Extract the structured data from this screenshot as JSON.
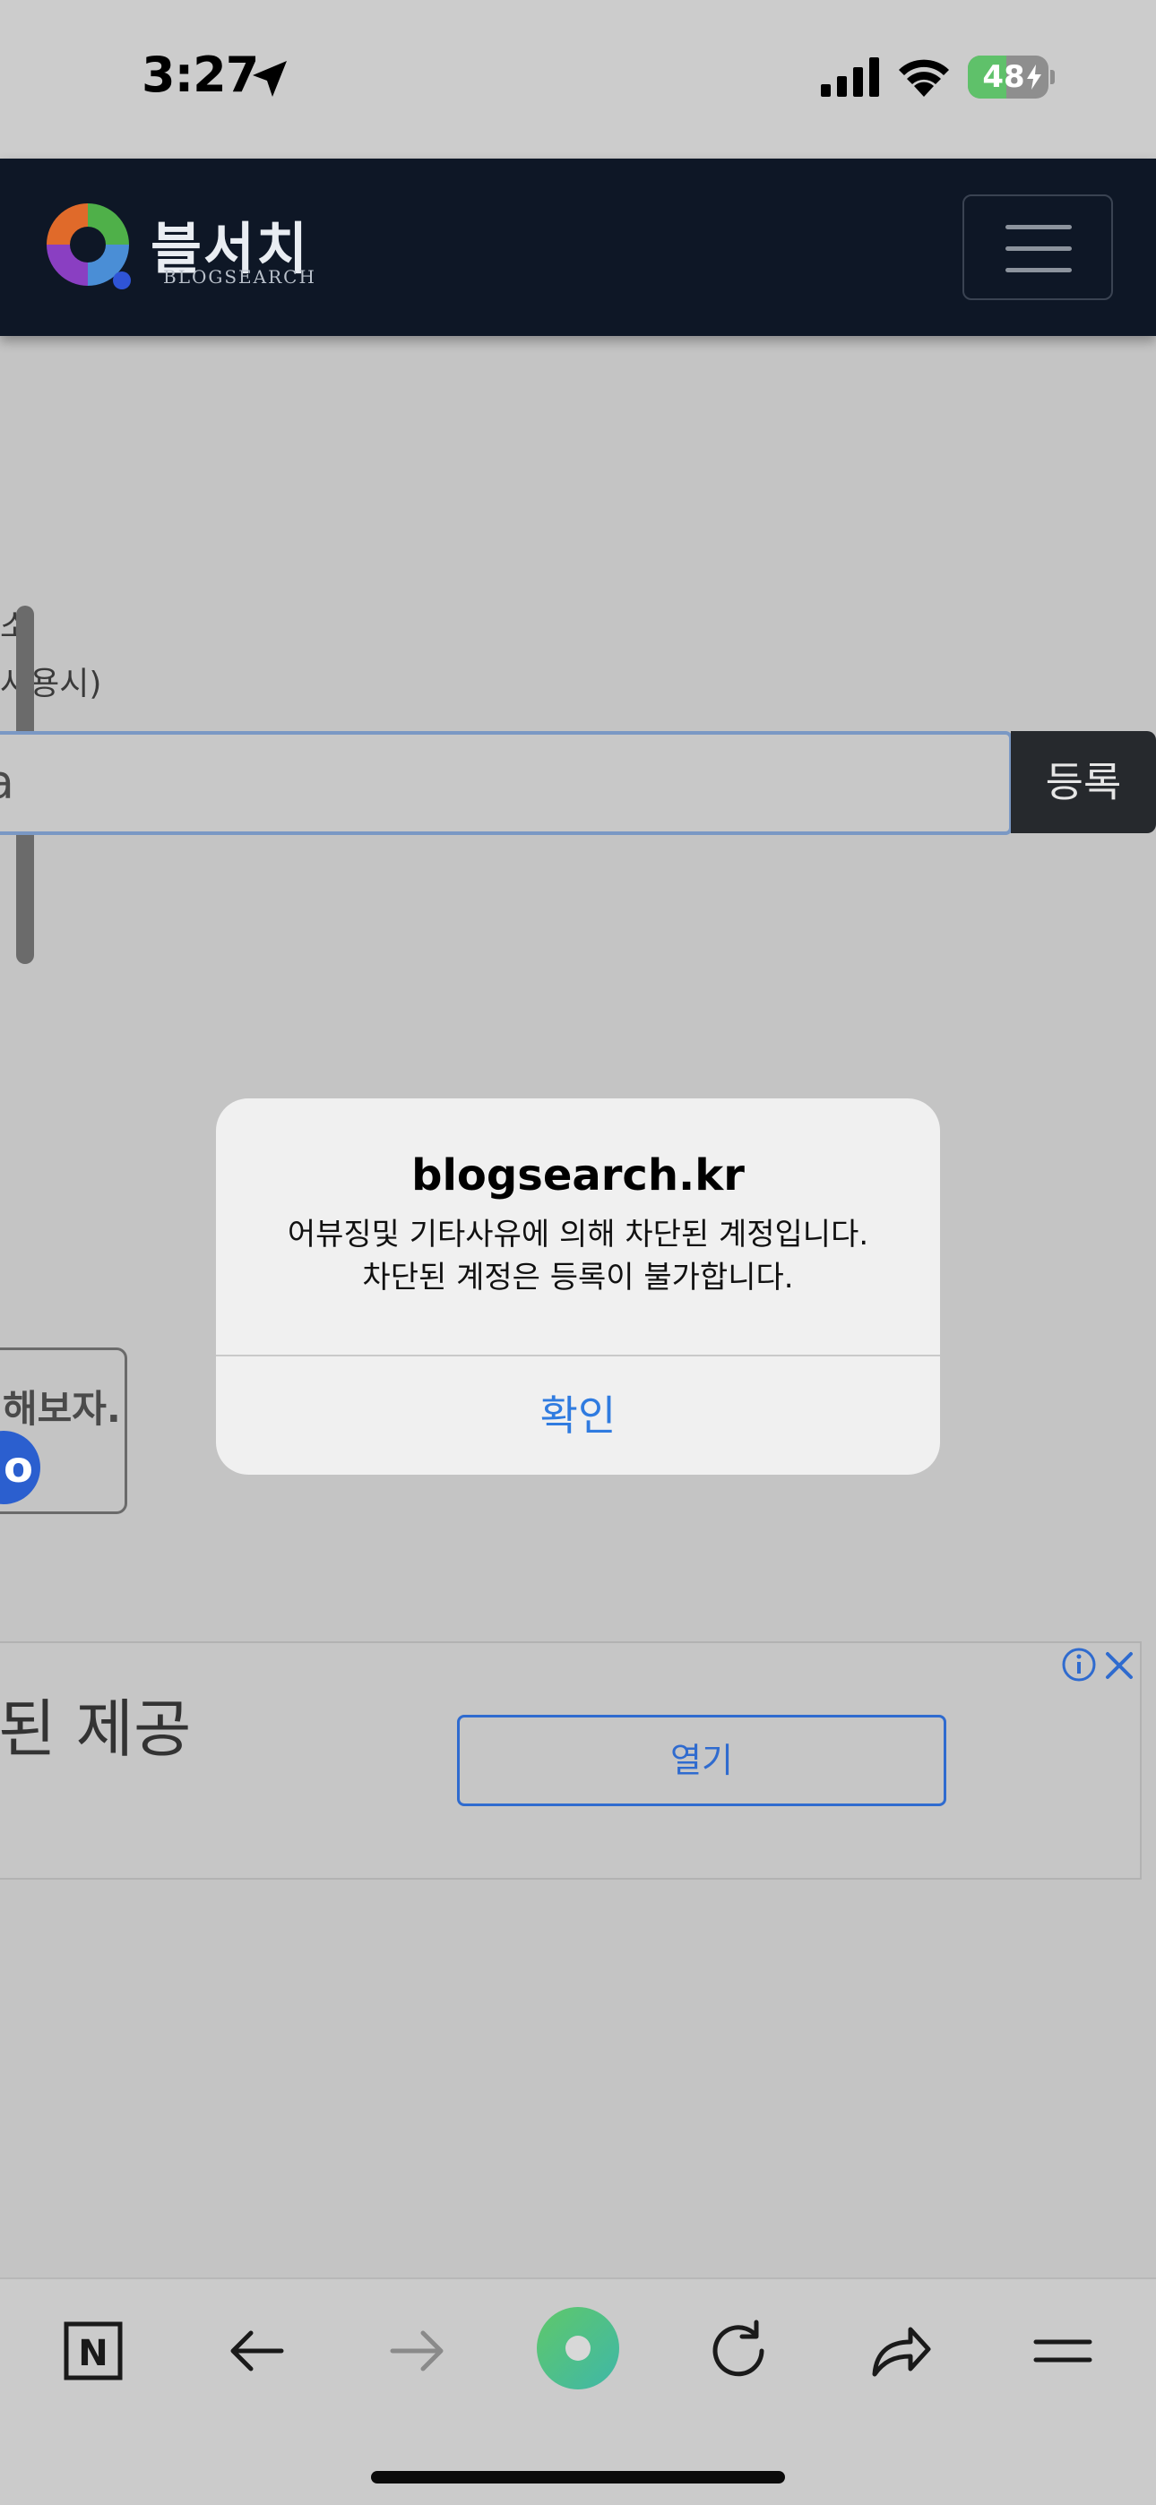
{
  "status_bar": {
    "time": "3:27",
    "battery_percent": "48",
    "battery_level": 0.48
  },
  "header": {
    "logo_title": "블서치",
    "logo_subtitle": "BLOGSEARCH"
  },
  "page": {
    "label_partial_1": "소",
    "label_partial_2": "사용시)",
    "input_partial_value": "a",
    "register_label": "등록",
    "promo_text": "해보자.",
    "promo_circle": "o"
  },
  "ad": {
    "headline_partial": "된 제공",
    "open_label": "열기"
  },
  "alert": {
    "title": "blogsearch.kr",
    "message_line1": "어뷰징및 기타사유에 의해 차단된 계정입니다.",
    "message_line2": "차단된 계정은 등록이 불가합니다.",
    "ok_label": "확인"
  },
  "toolbar": {
    "naver_label": "N"
  },
  "colors": {
    "header_bg": "#0e1726",
    "alert_ok": "#2f7be0",
    "battery_green": "#5fc16a",
    "ad_blue": "#2f6bcf"
  }
}
